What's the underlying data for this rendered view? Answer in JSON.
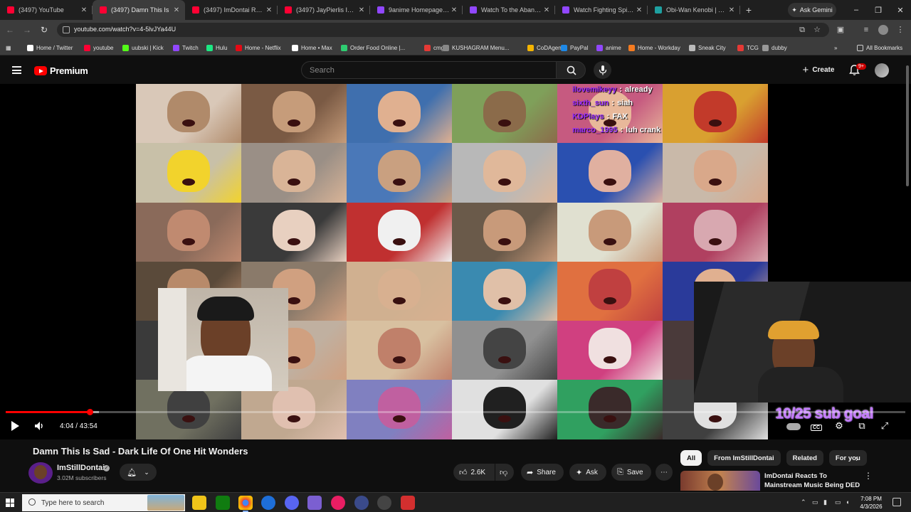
{
  "browser": {
    "tabs": [
      {
        "title": "(3497) YouTube",
        "favicon_color": "#ff0033",
        "active": false
      },
      {
        "title": "(3497) Damn This Is",
        "favicon_color": "#ff0033",
        "active": true
      },
      {
        "title": "(3497) ImDontai Reacts",
        "favicon_color": "#ff0033",
        "active": false
      },
      {
        "title": "(3497) JayPierlis Intervi",
        "favicon_color": "#ff0033",
        "active": false
      },
      {
        "title": "9anime Homepage: Be",
        "favicon_color": "#9147ff",
        "active": false
      },
      {
        "title": "Watch To the Abandon",
        "favicon_color": "#9147ff",
        "active": false
      },
      {
        "title": "Watch Fighting Spirit o",
        "favicon_color": "#9147ff",
        "active": false
      },
      {
        "title": "Obi-Wan Kenobi | Disn",
        "favicon_color": "#1ea0a0",
        "active": false
      }
    ],
    "new_tab": "+",
    "ask_gemini": "Ask Gemini",
    "window_controls": [
      "–",
      "❐",
      "✕"
    ],
    "url": "youtube.com/watch?v=4-5lvJYa44U",
    "bookmarks": [
      {
        "label": "Home / Twitter",
        "color": "#ffffff"
      },
      {
        "label": "youtube",
        "color": "#ff0033"
      },
      {
        "label": "uubski | Kick",
        "color": "#53fc18"
      },
      {
        "label": "Twitch",
        "color": "#9147ff"
      },
      {
        "label": "Hulu",
        "color": "#1ce783"
      },
      {
        "label": "Home - Netflix",
        "color": "#e50914"
      },
      {
        "label": "Home • Max",
        "color": "#ffffff"
      },
      {
        "label": "Order Food Online |...",
        "color": "#2ecc71"
      },
      {
        "label": "cmg",
        "color": "#e53935"
      },
      {
        "label": "KUSHAGRAM Menu...",
        "color": "#888888"
      },
      {
        "label": "CoDAgent",
        "color": "#f4b400"
      },
      {
        "label": "PayPal",
        "color": "#1e88e5"
      },
      {
        "label": "anime",
        "color": "#9147ff"
      },
      {
        "label": "Home - Workday",
        "color": "#f47b20"
      },
      {
        "label": "Sneak City",
        "color": "#bbbbbb"
      },
      {
        "label": "TCG",
        "color": "#e53935"
      },
      {
        "label": "dubby",
        "color": "#999999"
      }
    ],
    "all_bookmarks": "All Bookmarks"
  },
  "youtube": {
    "logo_text": "Premium",
    "search_placeholder": "Search",
    "create_label": "Create",
    "notification_count": "9+",
    "accent": "#ff0000"
  },
  "player": {
    "chat": [
      {
        "user": "ilovemikeyy",
        "message": "already"
      },
      {
        "user": "sixth_sun",
        "message": "siah"
      },
      {
        "user": "KDPlays",
        "message": "FAX"
      },
      {
        "user": "marco_1995",
        "message": "luh crank"
      }
    ],
    "sub_goal": "10/25 sub goal",
    "time": "4:04 / 43:54",
    "progress_fraction": 0.093,
    "buffered_fraction": 0.104
  },
  "video": {
    "title": "Damn This Is Sad - Dark Life Of One Hit Wonders",
    "channel": "ImStillDontai",
    "subscribers": "3.02M subscribers",
    "likes": "2.6K",
    "share_label": "Share",
    "ask_label": "Ask",
    "save_label": "Save",
    "more": "⋯"
  },
  "sidebar": {
    "chips": [
      "All",
      "From ImStillDontai",
      "Related",
      "For you"
    ],
    "recommendation": {
      "title": "ImDontai Reacts To Mainstream Music Being DED"
    }
  },
  "taskbar": {
    "search_placeholder": "Type here to search",
    "time": "7:08 PM",
    "date": "4/3/2026"
  }
}
